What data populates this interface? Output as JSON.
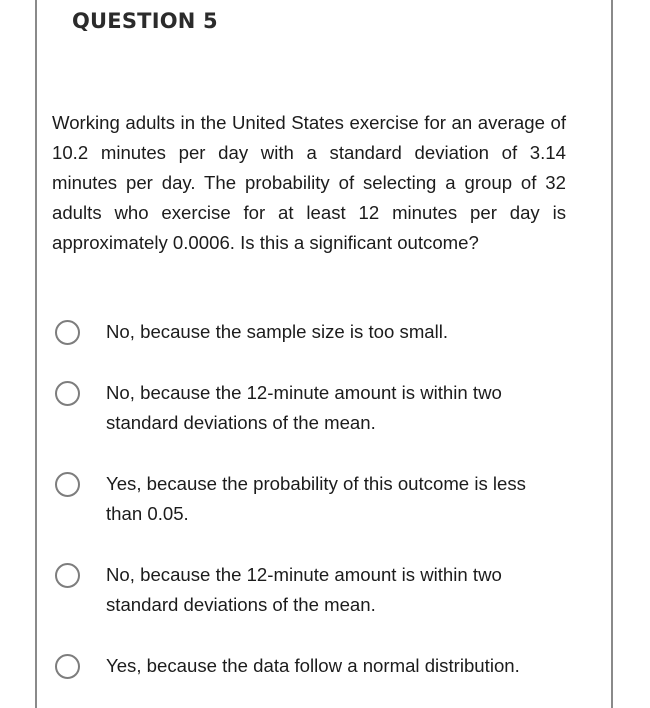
{
  "question": {
    "title": "QUESTION 5",
    "text": "Working adults in the United States exercise for an average of 10.2 minutes per day with a standard deviation of 3.14 minutes per day. The probability of selecting a group of 32 adults who exercise for at least 12 minutes per day is approximately 0.0006. Is this a significant outcome?",
    "options": [
      {
        "label": "No, because the sample size is too small.",
        "selected": false
      },
      {
        "label": "No, because the 12-minute amount is within two standard deviations of the mean.",
        "selected": false
      },
      {
        "label": "Yes, because the probability of this outcome is less than 0.05.",
        "selected": false
      },
      {
        "label": "No, because the 12-minute amount is within two standard deviations of the mean.",
        "selected": false
      },
      {
        "label": "Yes, because the data follow a normal distribution.",
        "selected": false
      }
    ]
  },
  "colors": {
    "border": "#8a8a8a",
    "radio_border": "#7d7d7d",
    "title_text": "#2b2b2b",
    "body_text": "#1c1c1c"
  }
}
